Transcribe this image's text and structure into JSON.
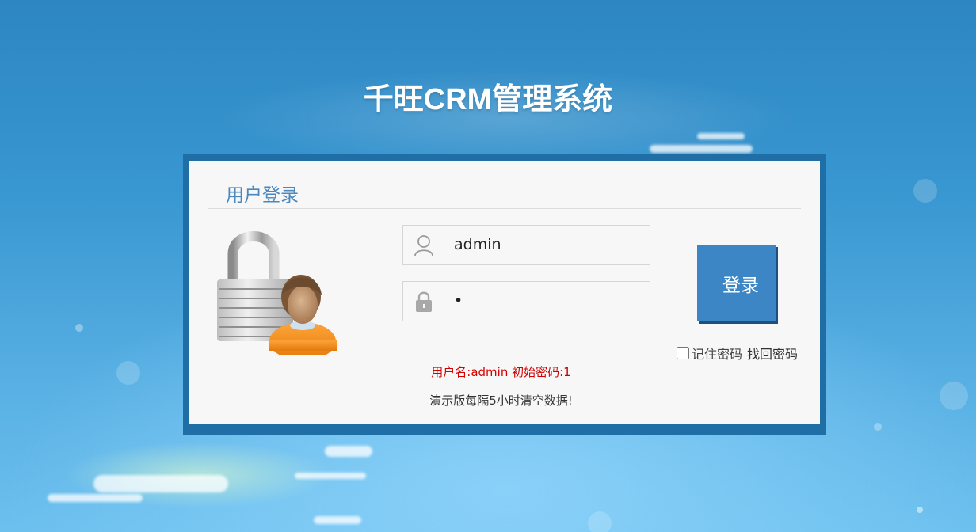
{
  "app": {
    "title": "千旺CRM管理系统"
  },
  "login_panel": {
    "heading": "用户登录",
    "username": {
      "value": "admin",
      "icon": "user-icon"
    },
    "password": {
      "value": "1",
      "icon": "lock-icon"
    },
    "submit_label": "登录",
    "remember_label": "记住密码",
    "remember_checked": false,
    "forgot_label": "找回密码",
    "credentials_hint": "用户名:admin 初始密码:1",
    "demo_notice": "演示版每隔5小时清空数据!",
    "illustration": "padlock-with-user-icon"
  },
  "colors": {
    "frame_border": "#1f6fa6",
    "heading": "#4a87bd",
    "button": "#3d86c6",
    "hint_red": "#d40000"
  }
}
